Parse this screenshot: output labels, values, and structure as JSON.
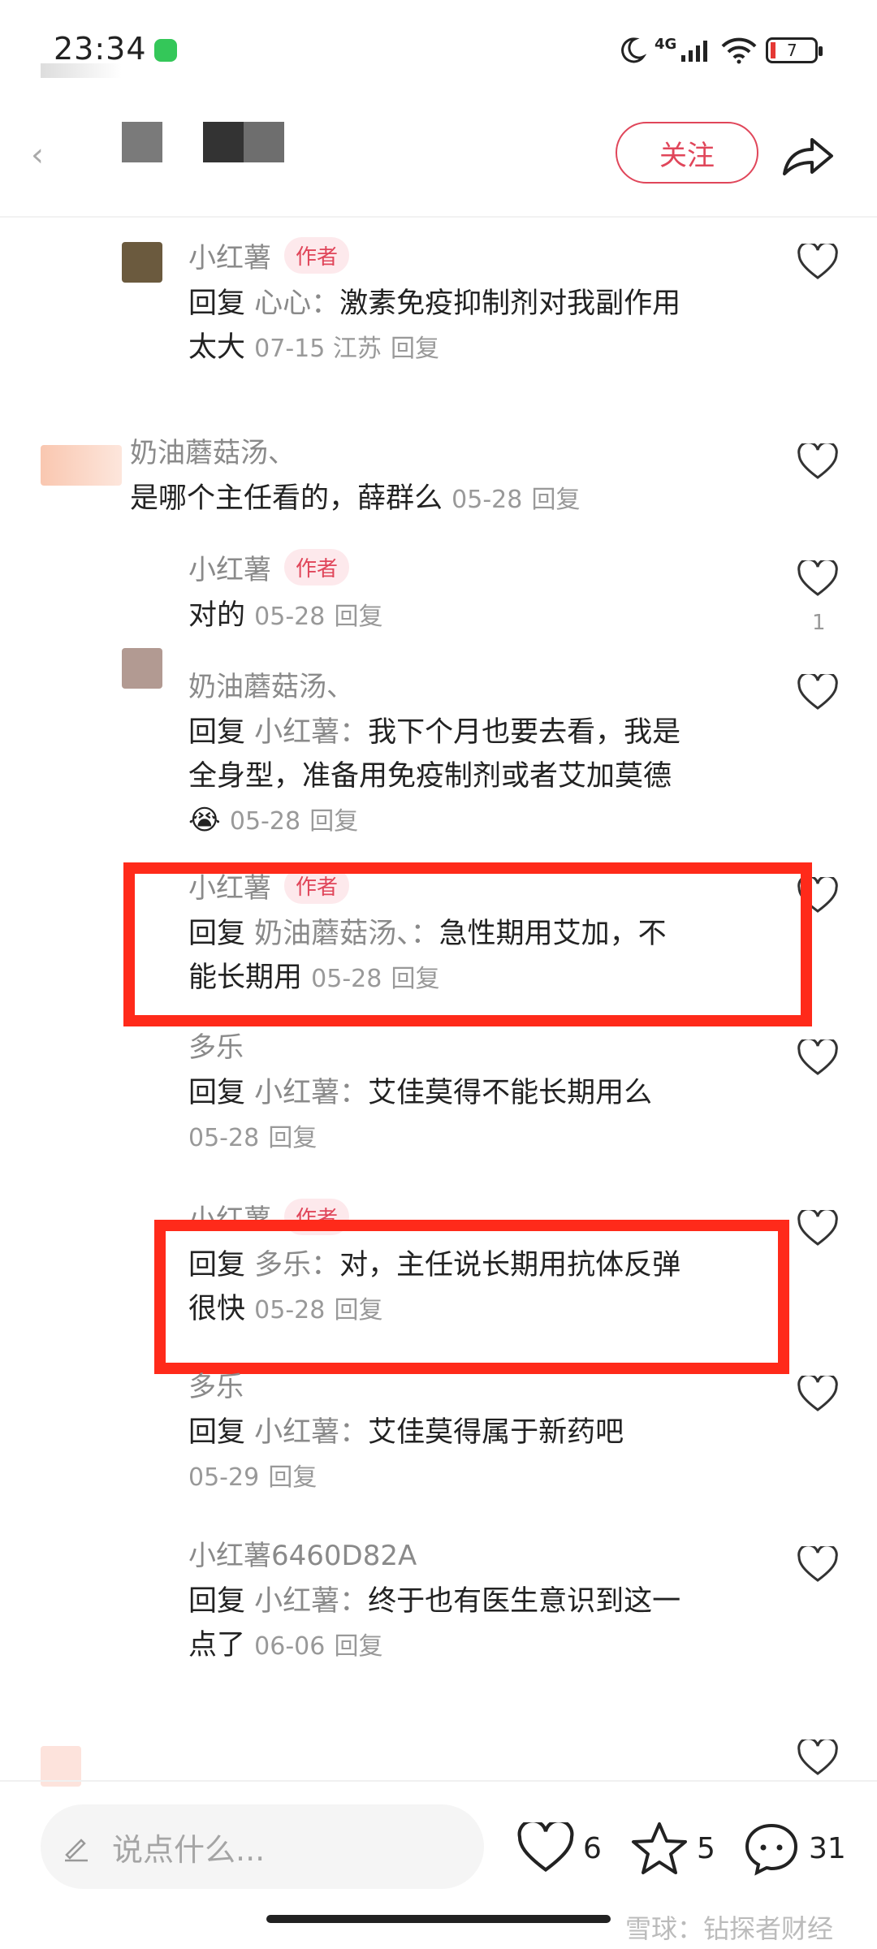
{
  "status_bar": {
    "time": "23:34",
    "network": "4G",
    "battery": "7"
  },
  "header": {
    "follow_label": "关注"
  },
  "comments": [
    {
      "name": "小红薯",
      "badge": "作者",
      "reply_prefix": "回复",
      "reply_to": "心心：",
      "text_line1": "激素免疫抑制剂对我副作用",
      "text_line2": "太大",
      "meta": "07-15 江苏",
      "reply_label": "回复"
    },
    {
      "name": "奶油蘑菇汤、",
      "text": "是哪个主任看的，薛群么",
      "meta": "05-28",
      "reply_label": "回复"
    },
    {
      "name": "小红薯",
      "badge": "作者",
      "text": "对的",
      "meta": "05-28",
      "reply_label": "回复",
      "like_count": "1"
    },
    {
      "name": "奶油蘑菇汤、",
      "reply_prefix": "回复",
      "reply_to": "小红薯：",
      "text_line1": "我下个月也要去看，我是",
      "text_line2": "全身型，准备用免疫制剂或者艾加莫德",
      "meta": "05-28",
      "reply_label": "回复"
    },
    {
      "name": "小红薯",
      "badge": "作者",
      "reply_prefix": "回复",
      "reply_to": "奶油蘑菇汤、：",
      "text_line1": "急性期用艾加，不",
      "text_line2": "能长期用",
      "meta": "05-28",
      "reply_label": "回复"
    },
    {
      "name": "多乐",
      "reply_prefix": "回复",
      "reply_to": "小红薯：",
      "text_line1": "艾佳莫得不能长期用么",
      "meta": "05-28",
      "reply_label": "回复"
    },
    {
      "name": "小红薯",
      "badge": "作者",
      "reply_prefix": "回复",
      "reply_to": "多乐：",
      "text_line1": "对，主任说长期用抗体反弹",
      "text_line2": "很快",
      "meta": "05-28",
      "reply_label": "回复"
    },
    {
      "name": "多乐",
      "reply_prefix": "回复",
      "reply_to": "小红薯：",
      "text_line1": "艾佳莫得属于新药吧",
      "meta": "05-29",
      "reply_label": "回复"
    },
    {
      "name": "小红薯6460D82A",
      "reply_prefix": "回复",
      "reply_to": "小红薯：",
      "text_line1": "终于也有医生意识到这一",
      "text_line2": "点了",
      "meta": "06-06",
      "reply_label": "回复"
    }
  ],
  "bottom_bar": {
    "placeholder": "说点什么...",
    "likes": "6",
    "stars": "5",
    "comments": "31"
  },
  "watermark": "雪球：钻探者财经",
  "colors": {
    "accent": "#e0465a",
    "highlight_box": "#ff2a1a"
  }
}
